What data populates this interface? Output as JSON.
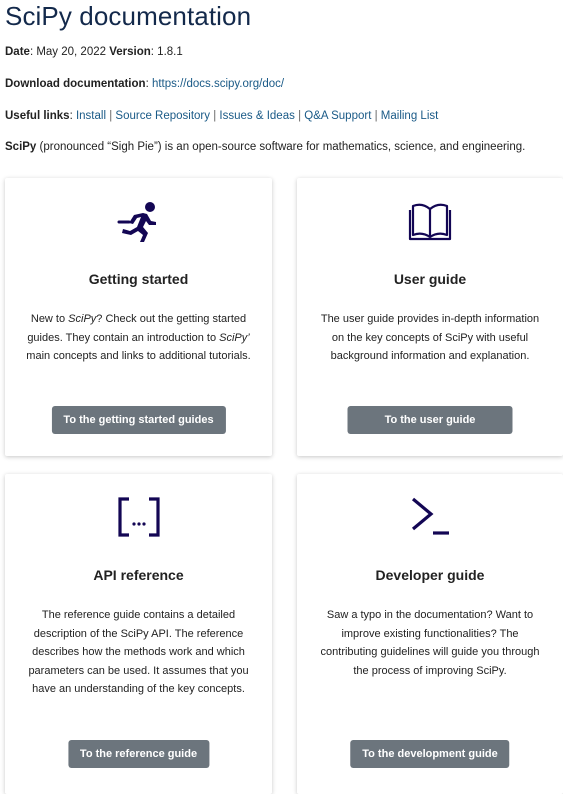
{
  "title": "SciPy documentation",
  "meta": {
    "date_label": "Date",
    "date_value": "May 20, 2022",
    "version_label": "Version",
    "version_value": "1.8.1",
    "download_label": "Download documentation",
    "download_link": "https://docs.scipy.org/doc/",
    "useful_links_label": "Useful links",
    "links": [
      "Install",
      "Source Repository",
      "Issues & Ideas",
      "Q&A Support",
      "Mailing List"
    ],
    "intro_name": "SciPy",
    "intro_rest": " (pronounced “Sigh Pie”) is an open-source software for mathematics, science, and engineering."
  },
  "cards": [
    {
      "title": "Getting started",
      "desc_parts": [
        "New to ",
        "SciPy",
        "? Check out the getting started guides. They contain an introduction to ",
        "SciPy’",
        " main concepts and links to additional tutorials."
      ],
      "button": "To the getting started guides",
      "icon": "running-person-icon"
    },
    {
      "title": "User guide",
      "desc": "The user guide provides in-depth information on the key concepts of SciPy with useful background information and explanation.",
      "button": "To the user guide",
      "icon": "open-book-icon"
    },
    {
      "title": "API reference",
      "desc": "The reference guide contains a detailed description of the SciPy API. The reference describes how the methods work and which parameters can be used. It assumes that you have an understanding of the key concepts.",
      "button": "To the reference guide",
      "icon": "code-brackets-icon"
    },
    {
      "title": "Developer guide",
      "desc": "Saw a typo in the documentation? Want to improve existing functionalities? The contributing guidelines will guide you through the process of improving SciPy.",
      "button": "To the development guide",
      "icon": "terminal-prompt-icon"
    }
  ],
  "colors": {
    "title": "#13294b",
    "link": "#1a5a87",
    "icon": "#130654",
    "button": "#6c757d"
  }
}
